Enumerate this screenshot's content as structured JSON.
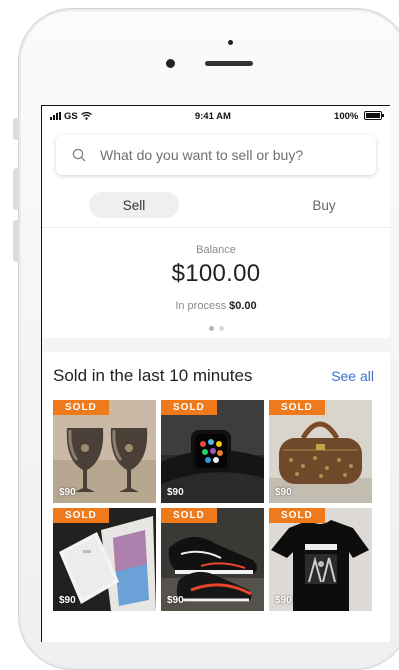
{
  "statusbar": {
    "carrier": "GS",
    "time": "9:41 AM",
    "battery": "100%"
  },
  "search": {
    "placeholder": "What do you want to sell or buy?"
  },
  "tabs": [
    {
      "label": "Sell",
      "active": true
    },
    {
      "label": "Buy",
      "active": false
    }
  ],
  "balance": {
    "label": "Balance",
    "amount": "$100.00",
    "in_process_label": "In process",
    "in_process_amount": "$0.00"
  },
  "sold_section": {
    "title": "Sold in the last 10 minutes",
    "see_all": "See all",
    "items": [
      {
        "badge": "SOLD",
        "price": "$90",
        "icon": "wine-glasses-image"
      },
      {
        "badge": "SOLD",
        "price": "$90",
        "icon": "smartwatch-image"
      },
      {
        "badge": "SOLD",
        "price": "$90",
        "icon": "duffel-bag-image"
      },
      {
        "badge": "SOLD",
        "price": "$90",
        "icon": "smartphone-box-image"
      },
      {
        "badge": "SOLD",
        "price": "$90",
        "icon": "sneakers-image"
      },
      {
        "badge": "SOLD",
        "price": "$90",
        "icon": "tshirt-image"
      }
    ]
  },
  "colors": {
    "accent": "#ee7a1c",
    "link": "#3b6fd1"
  }
}
